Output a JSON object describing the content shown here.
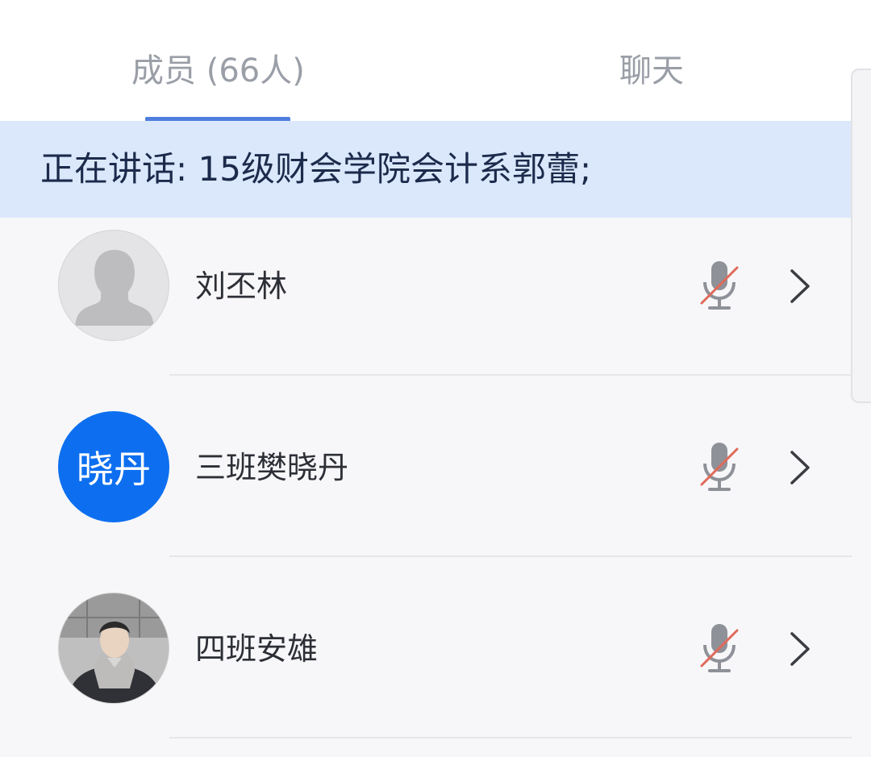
{
  "tabs": {
    "members_label": "成员 (66人)",
    "chat_label": "聊天",
    "active": "members",
    "accent_color": "#4f7ee0"
  },
  "speaking": {
    "text": "正在讲话: 15级财会学院会计系郭蕾;"
  },
  "members": [
    {
      "name": "刘丕林",
      "avatar_type": "default-silhouette",
      "avatar_text": "",
      "mic_status": "muted",
      "mic_icon": "mic-muted-icon",
      "chevron_icon": "chevron-right-icon"
    },
    {
      "name": "三班樊晓丹",
      "avatar_type": "text",
      "avatar_text": "晓丹",
      "avatar_color": "#0d6ff0",
      "mic_status": "muted",
      "mic_icon": "mic-muted-icon",
      "chevron_icon": "chevron-right-icon"
    },
    {
      "name": "四班安雄",
      "avatar_type": "photo",
      "avatar_text": "",
      "mic_status": "muted",
      "mic_icon": "mic-muted-icon",
      "chevron_icon": "chevron-right-icon"
    }
  ],
  "colors": {
    "banner_bg": "#dbe8fb",
    "banner_text": "#1c2a4b",
    "mic_gray": "#8e9198",
    "mute_slash": "#e06a5a"
  }
}
